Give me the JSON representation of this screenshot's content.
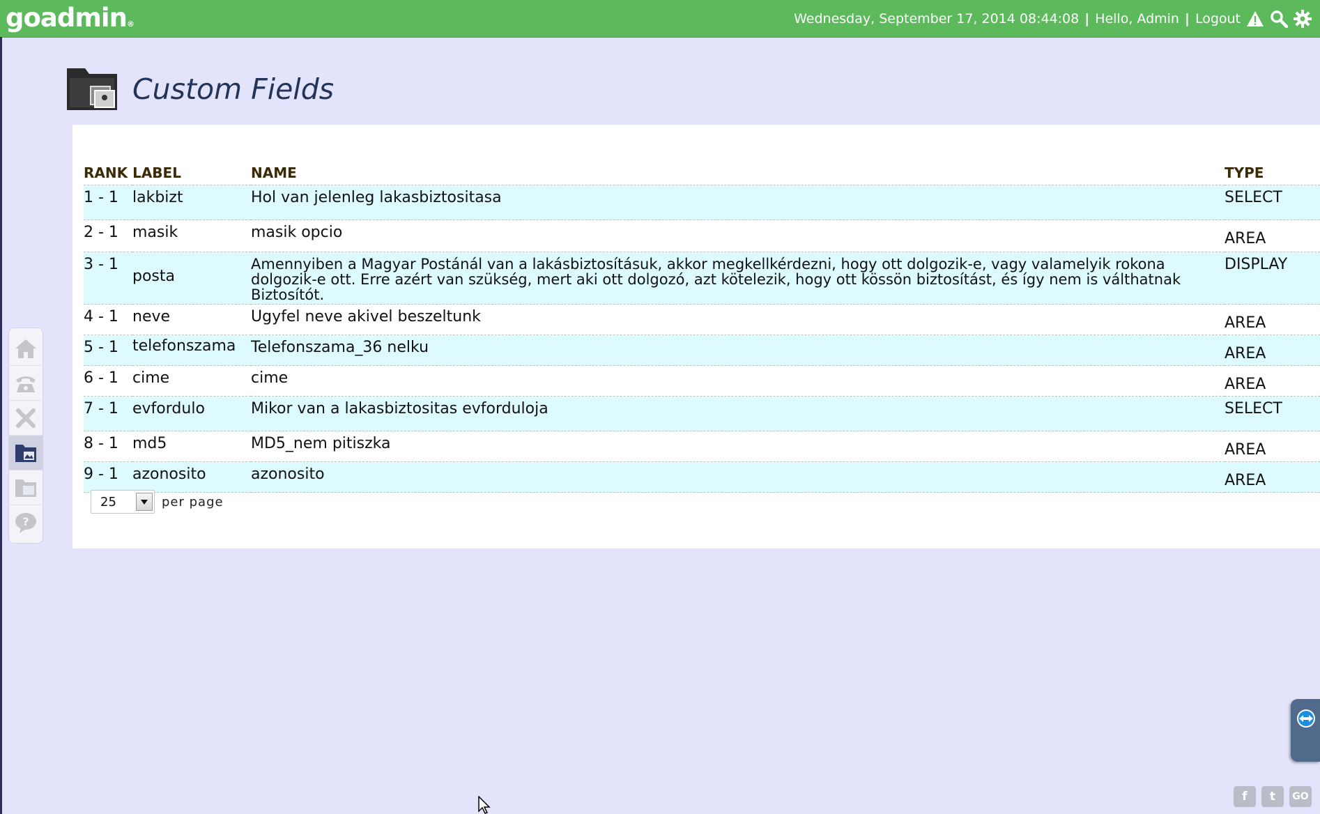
{
  "header": {
    "logo": "goadmin",
    "logo_mark": "®",
    "datetime": "Wednesday, September 17, 2014 08:44:08",
    "greeting": "Hello, Admin",
    "logout": "Logout",
    "separator": "|",
    "icons": [
      "alert-icon",
      "search-icon",
      "gear-icon"
    ]
  },
  "page": {
    "title": "Custom Fields",
    "title_icon": "folder-icon"
  },
  "table": {
    "headers": {
      "rank_label": "RANK LABEL",
      "name": "NAME",
      "type": "TYPE"
    },
    "rows": [
      {
        "rank": "1 - 1",
        "label": "lakbizt",
        "name": "Hol van jelenleg lakasbiztositasa",
        "type": "SELECT"
      },
      {
        "rank": "2 - 1",
        "label": "masik",
        "name": "masik opcio",
        "type": "AREA"
      },
      {
        "rank": "3 - 1",
        "label": "posta",
        "name": "Amennyiben a Magyar Postánál van a lakásbiztosításuk, akkor megkellkérdezni, hogy ott dolgozik-e, vagy valamelyik rokona dolgozik-e ott. Erre azért van szükség, mert aki ott dolgozó, azt kötelezik, hogy ott kössön biztosítást, és így nem is válthatnak Biztosítót.",
        "type": "DISPLAY"
      },
      {
        "rank": "4 - 1",
        "label": "neve",
        "name": "Ugyfel neve akivel beszeltunk",
        "type": "AREA"
      },
      {
        "rank": "5 - 1",
        "label": "telefonszama",
        "name": "Telefonszama_36 nelku",
        "type": "AREA"
      },
      {
        "rank": "6 - 1",
        "label": "cime",
        "name": "cime",
        "type": "AREA"
      },
      {
        "rank": "7 - 1",
        "label": "evfordulo",
        "name": "Mikor van a lakasbiztositas evforduloja",
        "type": "SELECT"
      },
      {
        "rank": "8 - 1",
        "label": "md5",
        "name": "MD5_nem pitiszka",
        "type": "AREA"
      },
      {
        "rank": "9 - 1",
        "label": "azonosito",
        "name": "azonosito",
        "type": "AREA"
      }
    ]
  },
  "pager": {
    "selected": "25",
    "label": "per page"
  },
  "sidebar": {
    "items": [
      {
        "icon": "home-icon",
        "active": false
      },
      {
        "icon": "phone-icon",
        "active": false
      },
      {
        "icon": "tools-icon",
        "active": false
      },
      {
        "icon": "folder-icon",
        "active": true
      },
      {
        "icon": "report-icon",
        "active": false
      },
      {
        "icon": "help-icon",
        "active": false
      }
    ]
  },
  "social": {
    "facebook": "f",
    "twitter": "t",
    "go": "GO"
  },
  "colors": {
    "topbar": "#5cba5c",
    "background": "#e3e4fb",
    "row_alt": "#ddfbff",
    "title": "#23345a"
  }
}
